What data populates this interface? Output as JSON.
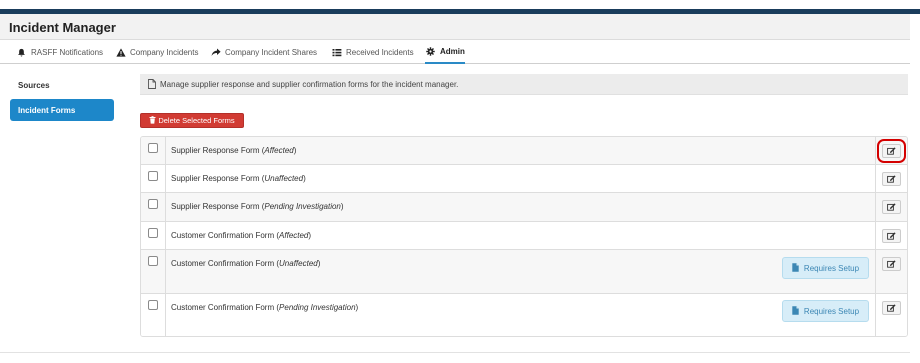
{
  "app": {
    "title": "Incident Manager"
  },
  "tabs": [
    {
      "label": "RASFF Notifications",
      "icon": "bell-icon"
    },
    {
      "label": "Company Incidents",
      "icon": "warning-icon"
    },
    {
      "label": "Company Incident Shares",
      "icon": "share-icon"
    },
    {
      "label": "Received Incidents",
      "icon": "list-icon"
    },
    {
      "label": "Admin",
      "icon": "gear-icon",
      "active": true
    }
  ],
  "sidebar": {
    "items": [
      {
        "label": "Sources"
      },
      {
        "label": "Incident Forms",
        "active": true
      }
    ]
  },
  "info": {
    "text": "Manage supplier response and supplier confirmation forms for the incident manager."
  },
  "toolbar": {
    "delete_label": "Delete Selected Forms"
  },
  "forms": [
    {
      "name": "Supplier Response Form",
      "qualifier": "Affected",
      "requires_setup": false,
      "highlighted": true
    },
    {
      "name": "Supplier Response Form",
      "qualifier": "Unaffected",
      "requires_setup": false
    },
    {
      "name": "Supplier Response Form",
      "qualifier": "Pending Investigation",
      "requires_setup": false
    },
    {
      "name": "Customer Confirmation Form",
      "qualifier": "Affected",
      "requires_setup": false
    },
    {
      "name": "Customer Confirmation Form",
      "qualifier": "Unaffected",
      "requires_setup": true
    },
    {
      "name": "Customer Confirmation Form",
      "qualifier": "Pending Investigation",
      "requires_setup": true
    }
  ],
  "requires_setup_label": "Requires Setup",
  "colors": {
    "accent": "#1d87c9",
    "danger": "#d13b33",
    "info_bg": "#d7edf8",
    "highlight": "#d40000"
  }
}
